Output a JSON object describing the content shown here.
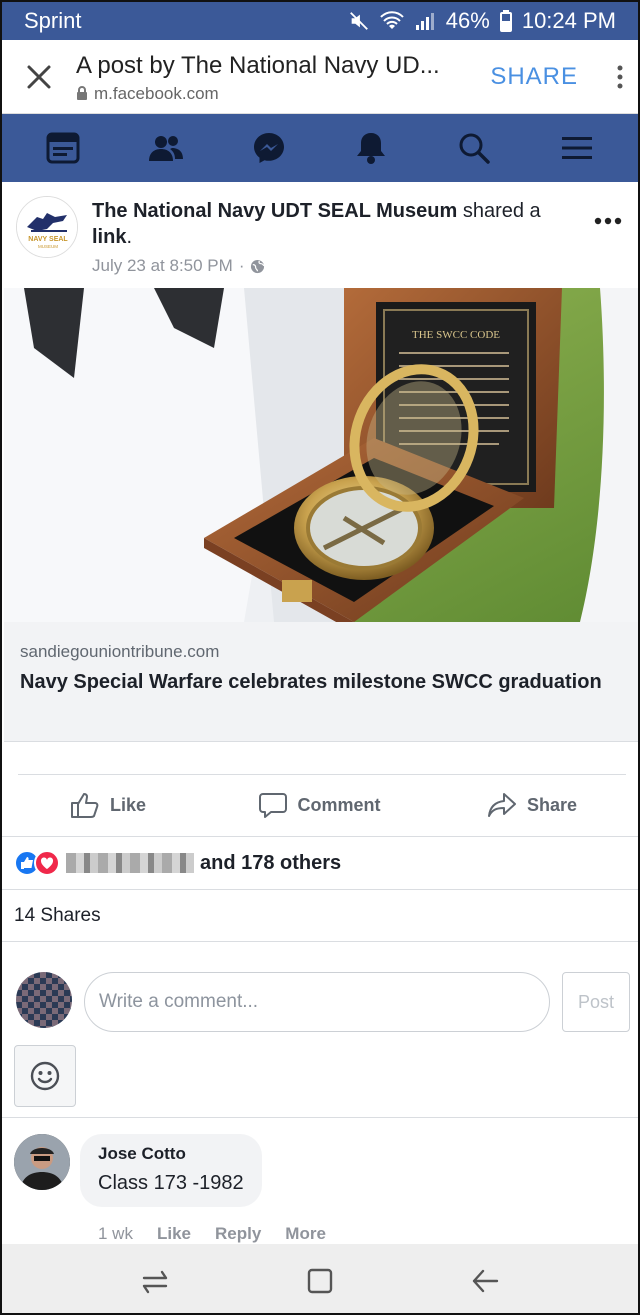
{
  "status_bar": {
    "carrier": "Sprint",
    "battery": "46%",
    "time": "10:24 PM"
  },
  "browser": {
    "title": "A post by The National Navy UD...",
    "url": "m.facebook.com",
    "share_label": "SHARE"
  },
  "fb_nav": {
    "items": [
      "news-feed-icon",
      "friends-icon",
      "messenger-icon",
      "notifications-icon",
      "search-icon",
      "menu-icon"
    ]
  },
  "post": {
    "author": "The National Navy UDT SEAL Museum",
    "action_text": " shared a ",
    "action_link": "link",
    "action_end": ".",
    "timestamp": "July 23 at 8:50 PM",
    "separator": "·",
    "page_logo_text": "NAVY SEAL",
    "page_logo_sub": "MUSEUM",
    "image_plaque_title": "THE SWCC CODE",
    "link": {
      "domain": "sandiegouniontribune.com",
      "headline": "Navy Special Warfare celebrates milestone SWCC graduation"
    }
  },
  "actions": {
    "like": "Like",
    "comment": "Comment",
    "share": "Share"
  },
  "reactions": {
    "others": "and 178 others"
  },
  "shares": {
    "count_text": "14 Shares"
  },
  "composer": {
    "placeholder": "Write a comment...",
    "post_label": "Post"
  },
  "comment": {
    "author": "Jose Cotto",
    "text": "Class 173 -1982",
    "time": "1 wk",
    "like": "Like",
    "reply": "Reply",
    "more": "More"
  },
  "colors": {
    "facebook_blue": "#3b5998",
    "link_blue": "#4a90e2",
    "like_blue": "#1877f2",
    "love_red": "#f0284a"
  }
}
